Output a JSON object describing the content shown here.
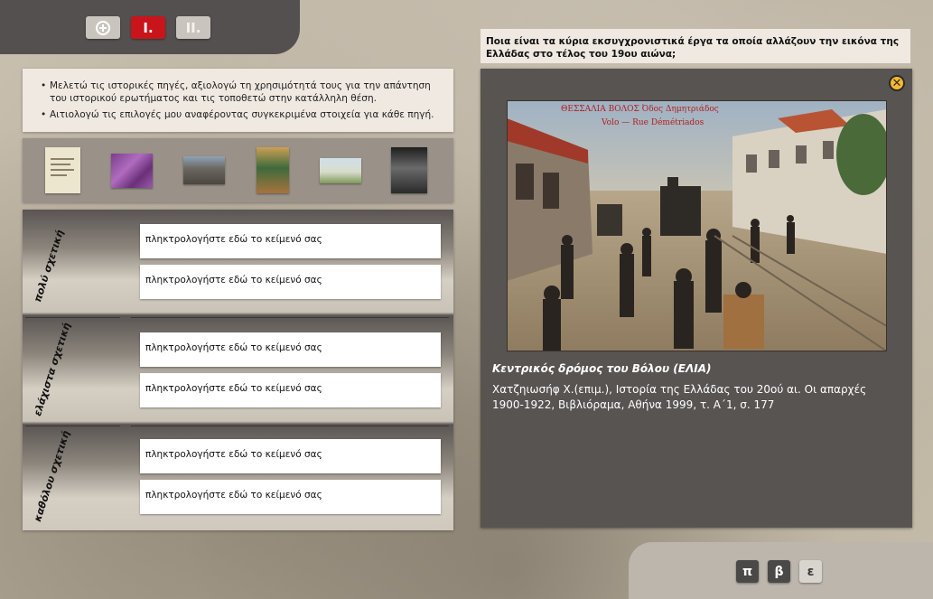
{
  "topbar": {
    "home_icon": "home-circle-icon",
    "btn_one": "I.",
    "btn_two": "II."
  },
  "instructions": [
    "Μελετώ τις ιστορικές πηγές, αξιολογώ τη χρησιμότητά τους για την απάντηση του ιστορικού ερωτήματος και τις τοποθετώ στην κατάλληλη θέση.",
    "Αιτιολογώ τις επιλογές μου αναφέροντας συγκεκριμένα στοιχεία για κάθε πηγή."
  ],
  "thumbnails": [
    "document-thumbnail",
    "purple-map-thumbnail",
    "street-photo-thumbnail",
    "book-cover-thumbnail",
    "landscape-thumbnail",
    "portrait-book-thumbnail"
  ],
  "categories": [
    "πολύ σχετική",
    "ελάχιστα σχετική",
    "καθόλου σχετική"
  ],
  "field_placeholder": "πληκτρολογήστε εδώ το κείμενό σας",
  "question": "Ποια είναι τα κύρια εκσυγχρονιστικά έργα τα οποία αλλάζουν την εικόνα της Ελλάδας στο τέλος του 19ου αιώνα;",
  "viewer": {
    "close_icon": "close-x-icon",
    "photo_caption_top": "ΘΕΣΣΑΛΙΑ   ΒΟΛΟΣ  Όδος Δημητριάδος",
    "photo_caption_sub": "Volo — Rue Démétriados",
    "caption": "Κεντρικός δρόμος του Βόλου (ΕΛΙΑ)",
    "source": "Χατζηιωσήφ Χ.(επιμ.), Ιστορία της Ελλάδας του 20ού αι. Οι απαρχές 1900-1922, Βιβλιόραμα, Αθήνα 1999, τ. Α΄1, σ. 177"
  },
  "bottombar": {
    "b1": "π",
    "b2": "β",
    "b3": "ε"
  },
  "colors": {
    "accent_red": "#c9141c",
    "dark_panel": "#585452",
    "close_icon_yellow": "#f5b82e"
  }
}
